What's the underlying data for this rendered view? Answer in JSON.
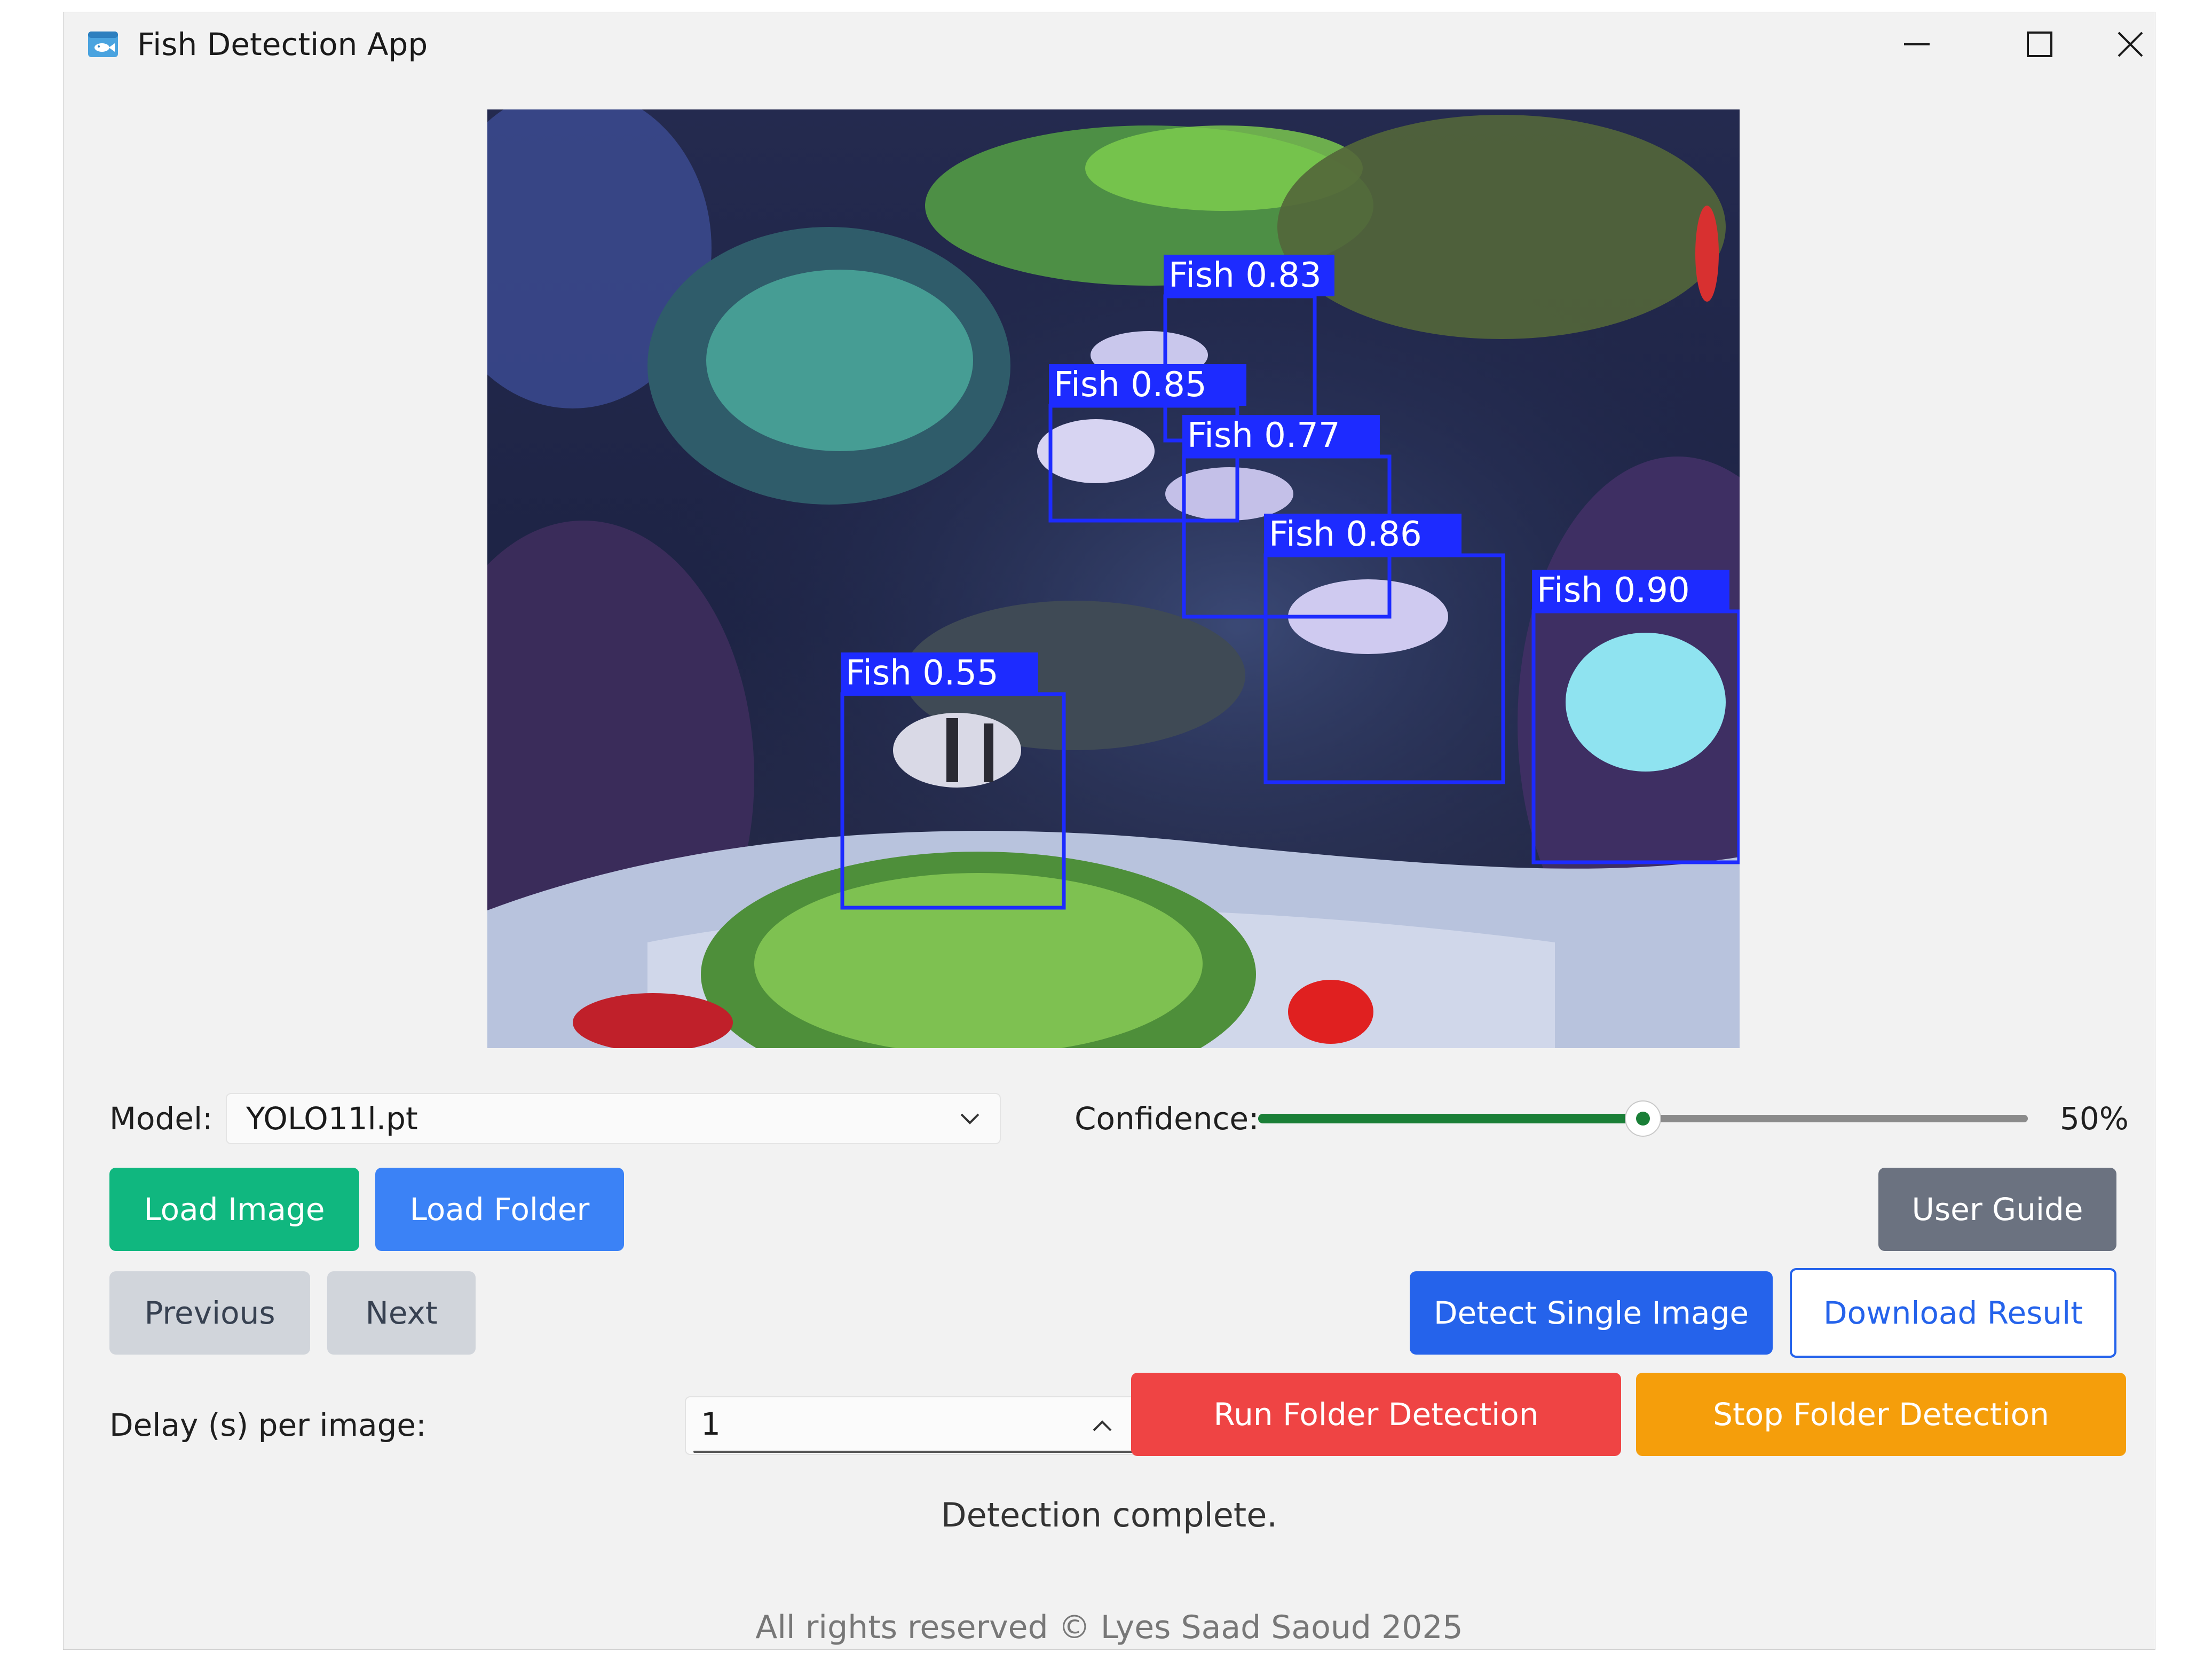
{
  "window": {
    "title": "Fish Detection App"
  },
  "viewer": {
    "detections": [
      {
        "label": "Fish 0.83"
      },
      {
        "label": "Fish 0.85"
      },
      {
        "label": "Fish 0.77"
      },
      {
        "label": "Fish 0.86"
      },
      {
        "label": "Fish 0.90"
      },
      {
        "label": "Fish 0.55"
      }
    ],
    "box_color": "#1d2bff"
  },
  "controls": {
    "model_label": "Model:",
    "model_value": "YOLO11l.pt",
    "confidence_label": "Confidence:",
    "confidence_fraction": 0.5,
    "confidence_value": "50%",
    "load_image": "Load Image",
    "load_folder": "Load Folder",
    "user_guide": "User Guide",
    "previous": "Previous",
    "next": "Next",
    "detect_single": "Detect Single Image",
    "download_result": "Download Result",
    "delay_label": "Delay (s) per image:",
    "delay_value": "1",
    "run_folder": "Run Folder Detection",
    "stop_folder": "Stop Folder Detection"
  },
  "status": "Detection complete.",
  "footer": "All rights reserved © Lyes Saad Saoud 2025",
  "colors": {
    "accent_green": "#10b77f",
    "accent_blue": "#3b82f6",
    "primary_blue": "#2563eb",
    "danger": "#ef4444",
    "warning": "#f59e0b",
    "neutral": "#6b7280",
    "slider_fill": "#1a7f37"
  }
}
